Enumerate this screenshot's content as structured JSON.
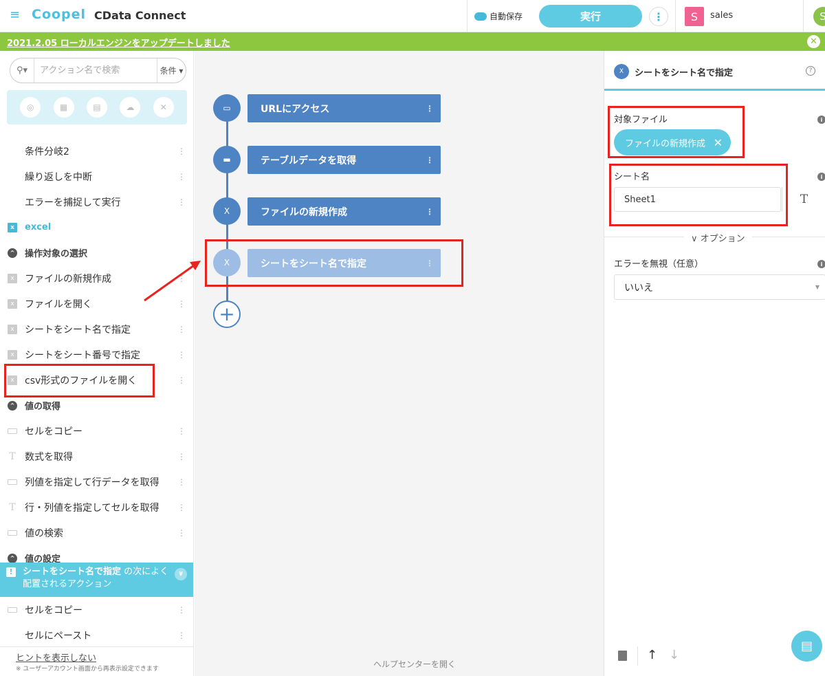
{
  "header": {
    "logo": "Coopel",
    "app_title": "CData Connect",
    "autosave": "自動保存",
    "run_label": "実行",
    "more_label": "⋮",
    "workspace_initial": "S",
    "workspace_name": "sales",
    "user_initial": "S"
  },
  "notice": {
    "text": "2021.2.05 ローカルエンジンをアップデートしました",
    "close": "✕"
  },
  "sidebar": {
    "search_placeholder": "アクション名で検索",
    "search_filter": "条件 ▾",
    "items": [
      {
        "label": "条件分岐2",
        "type": "plain"
      },
      {
        "label": "繰り返しを中断",
        "type": "plain"
      },
      {
        "label": "エラーを捕捉して実行",
        "type": "plain"
      },
      {
        "label": "excel",
        "type": "category"
      },
      {
        "label": "操作対象の選択",
        "type": "section"
      },
      {
        "label": "ファイルの新規作成",
        "type": "excel"
      },
      {
        "label": "ファイルを開く",
        "type": "excel"
      },
      {
        "label": "シートをシート名で指定",
        "type": "sheet"
      },
      {
        "label": "シートをシート番号で指定",
        "type": "sheet"
      },
      {
        "label": "csv形式のファイルを開く",
        "type": "excel"
      },
      {
        "label": "値の取得",
        "type": "section"
      },
      {
        "label": "セルをコピー",
        "type": "bars"
      },
      {
        "label": "数式を取得",
        "type": "text"
      },
      {
        "label": "列値を指定して行データを取得",
        "type": "bars"
      },
      {
        "label": "行・列値を指定してセルを取得",
        "type": "text"
      },
      {
        "label": "値の検索",
        "type": "bars"
      },
      {
        "label": "値の設定",
        "type": "section"
      }
    ],
    "suggest": {
      "action": "シートをシート名で指定",
      "text": " の次によく配置されるアクション"
    },
    "suggest_items": [
      {
        "label": "セルをコピー",
        "type": "bars"
      },
      {
        "label": "セルにペースト",
        "type": "plain"
      }
    ],
    "hint_link": "ヒントを表示しない",
    "hint_note": "※ ユーザーアカウント画面から再表示設定できます"
  },
  "canvas": {
    "nodes": [
      {
        "label": "URLにアクセス",
        "icon": "browser-icon"
      },
      {
        "label": "テーブルデータを取得",
        "icon": "table-icon"
      },
      {
        "label": "ファイルの新規作成",
        "icon": "excel-icon"
      },
      {
        "label": "シートをシート名で指定",
        "icon": "sheet-icon"
      }
    ],
    "help_link": "ヘルプセンターを開く"
  },
  "panel": {
    "title": "シートをシート名で指定",
    "target_file_label": "対象ファイル",
    "target_file_value": "ファイルの新規作成",
    "sheet_name_label": "シート名",
    "sheet_name_value": "Sheet1",
    "text_mode": "T",
    "options_label": "∨ オプション",
    "ignore_error_label": "エラーを無視（任意）",
    "ignore_error_value": "いいえ"
  },
  "colors": {
    "accent": "#5ecbe3",
    "node": "#4e83c4",
    "node_active": "#9dbde4",
    "notice": "#8dc63f",
    "highlight": "#e8231d"
  }
}
